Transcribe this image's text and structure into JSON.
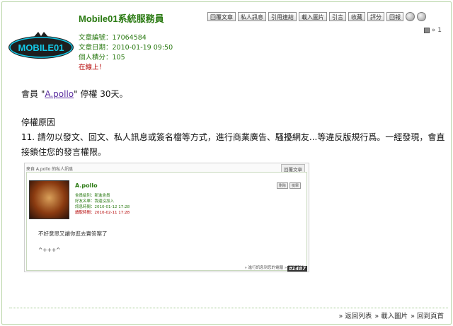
{
  "author": {
    "name": "Mobile01系統服務員",
    "logo_text": "MOBILE01"
  },
  "toolbar": {
    "buttons": [
      "回覆文章",
      "私人訊息",
      "引用連結",
      "載入圖片",
      "引言",
      "收藏",
      "評分",
      "回報"
    ]
  },
  "post_number": "1",
  "meta": {
    "article_id": "文章編號：17064584",
    "article_date": "文章日期：2010-01-19 09:50",
    "points": "個人積分：105",
    "status": "在線上！"
  },
  "content": {
    "line1_prefix": "會員 \"",
    "member_link": "A.pollo",
    "line1_suffix": "\" 停權 30天。",
    "reason_title": "停權原因",
    "reason_text": "11. 請勿以發文、回文、私人訊息或簽名檔等方式，進行商業廣告、騷擾網友...等違反版規行爲。一經發現，會直接鎖住您的發言權限。"
  },
  "screenshot": {
    "header": "來自 A.pollo 的私人訊息",
    "back_button": "回覆文章",
    "name": "A.pollo",
    "buttons": [
      "刪除",
      "檢舉"
    ],
    "meta": [
      "會員級別：新進會員",
      "好友名單：我還沒加入",
      "訊息時間：2010-01-12 17:28",
      "讀取時間：2010-02-11 17:28"
    ],
    "message1": "不好意思又讓你逛去賣答案了",
    "message2": "^+++^",
    "footer": "» 進行訊息到您的電腦 » 回到頂端",
    "tag": "#1487"
  },
  "footer_nav": [
    "» 返回列表",
    "» 載入圖片",
    "» 回到頁首"
  ]
}
